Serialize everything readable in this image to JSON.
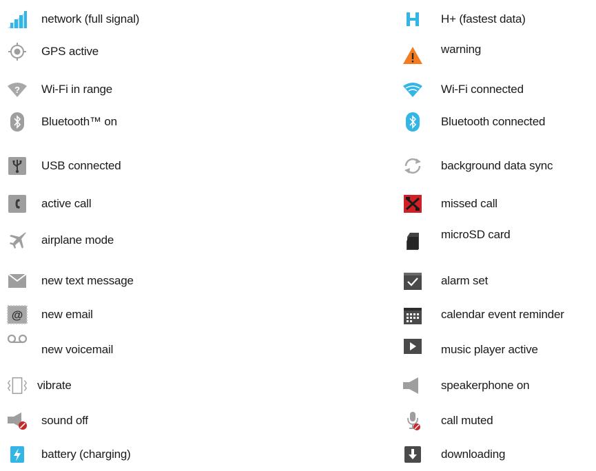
{
  "left": [
    {
      "icon": "signal-icon",
      "label": "network (full signal)"
    },
    {
      "icon": "gps-icon",
      "label": "GPS active"
    },
    {
      "icon": "wifi-range-icon",
      "label": "Wi-Fi in range"
    },
    {
      "icon": "bluetooth-on-icon",
      "label": "Bluetooth™ on"
    },
    {
      "icon": "usb-icon",
      "label": "USB connected"
    },
    {
      "icon": "active-call-icon",
      "label": "active call"
    },
    {
      "icon": "airplane-icon",
      "label": "airplane mode"
    },
    {
      "icon": "text-message-icon",
      "label": "new text message"
    },
    {
      "icon": "email-icon",
      "label": "new email"
    },
    {
      "icon": "voicemail-icon",
      "label": "new voicemail"
    },
    {
      "icon": "vibrate-icon",
      "label": "vibrate"
    },
    {
      "icon": "sound-off-icon",
      "label": "sound off"
    },
    {
      "icon": "battery-charging-icon",
      "label": "battery (charging)"
    }
  ],
  "right": [
    {
      "icon": "hplus-icon",
      "label": "H+ (fastest data)"
    },
    {
      "icon": "warning-icon",
      "label": "warning"
    },
    {
      "icon": "wifi-connected-icon",
      "label": "Wi-Fi connected"
    },
    {
      "icon": "bluetooth-connected-icon",
      "label": "Bluetooth connected"
    },
    {
      "icon": "sync-icon",
      "label": "background data sync"
    },
    {
      "icon": "missed-call-icon",
      "label": "missed call"
    },
    {
      "icon": "microsd-icon",
      "label": "microSD card"
    },
    {
      "icon": "alarm-icon",
      "label": "alarm set"
    },
    {
      "icon": "calendar-icon",
      "label": "calendar event reminder"
    },
    {
      "icon": "music-player-icon",
      "label": "music player active"
    },
    {
      "icon": "speakerphone-icon",
      "label": "speakerphone on"
    },
    {
      "icon": "call-muted-icon",
      "label": "call muted"
    },
    {
      "icon": "downloading-icon",
      "label": "downloading"
    }
  ],
  "colors": {
    "accent_blue": "#33b5e5",
    "icon_gray": "#9e9e9e",
    "warning_orange": "#f47c20",
    "missed_red": "#d11f26"
  }
}
